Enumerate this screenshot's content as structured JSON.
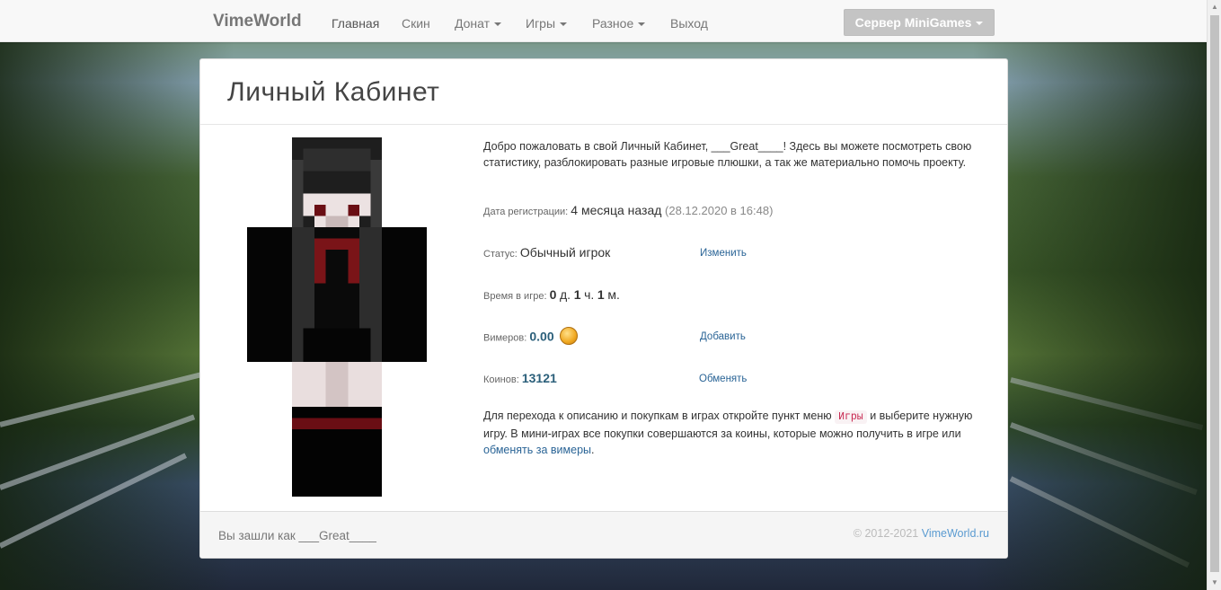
{
  "navbar": {
    "brand": "VimeWorld",
    "items": [
      {
        "label": "Главная",
        "active": true
      },
      {
        "label": "Скин",
        "dropdown": false
      },
      {
        "label": "Донат",
        "dropdown": true
      },
      {
        "label": "Игры",
        "dropdown": true
      },
      {
        "label": "Разное",
        "dropdown": true
      },
      {
        "label": "Выход",
        "dropdown": false
      }
    ],
    "server_button": "Сервер MiniGames"
  },
  "panel": {
    "title": "Личный Кабинет",
    "intro": "Добро пожаловать в свой Личный Кабинет, ___Great____! Здесь вы можете посмотреть свою статистику, разблокировать разные игровые плюшки, а так же материально помочь проекту.",
    "registration": {
      "label": "Дата регистрации",
      "value": "4 месяца назад",
      "date": "(28.12.2020 в 16:48)"
    },
    "status": {
      "label": "Статус",
      "value": "Обычный игрок",
      "action": "Изменить"
    },
    "playtime": {
      "label": "Время в игре",
      "days": "0",
      "days_unit": "д.",
      "hours": "1",
      "hours_unit": "ч.",
      "minutes": "1",
      "minutes_unit": "м."
    },
    "vimers": {
      "label": "Вимеров",
      "value": "0.00",
      "icon": "vimer-coin-icon",
      "action": "Добавить"
    },
    "coins": {
      "label": "Коинов",
      "value": "13121",
      "action": "Обменять"
    },
    "note": {
      "part1": "Для перехода к описанию и покупкам в играх откройте пункт меню",
      "code": "Игры",
      "part2": "и выберите нужную игру. В мини-играх все покупки совершаются за коины, которые можно получить в игре или",
      "link": "обменять за вимеры",
      "end": "."
    },
    "footer": {
      "logged_in_as": "Вы зашли как ___Great____",
      "copyright": "© 2012-2021",
      "site_link": "VimeWorld.ru"
    }
  },
  "colors": {
    "link": "#2a6496",
    "money": "#2b5f7a",
    "code_text": "#c7254e",
    "server_button": "#c4c4c4"
  }
}
